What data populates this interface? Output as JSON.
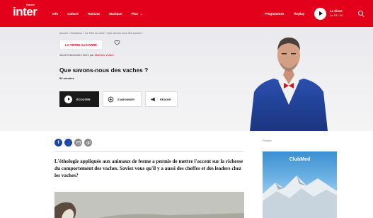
{
  "nav": {
    "logo_top": "france",
    "logo_main": "inter",
    "links": [
      "Info",
      "Culture",
      "Humour",
      "Musique",
      "Plus"
    ],
    "right_links": [
      "Programmes",
      "Replay"
    ],
    "live_label": "Le direct",
    "live_sub": "Le 13 / 14",
    "accent_color": "#e2001a"
  },
  "hero": {
    "breadcrumb": "Accueil  >  Émissions  >  La Terre au carré  >  Que savons-nous des vaches ?",
    "show_tag": "LA TERRE AU CARRÉ",
    "date_prefix": "Jeudi 9 décembre 2021 par ",
    "author": "Mathieu Vidard",
    "title": "Que savons-nous des vaches ?",
    "duration": "54 minutes",
    "actions": {
      "listen": "ÉCOUTER",
      "subscribe": "S'ABONNER",
      "react": "RÉAGIR"
    }
  },
  "article": {
    "share_icons": [
      "facebook-icon",
      "twitter-icon",
      "mail-icon",
      "link-icon"
    ],
    "lead": "L'éthologie appliquée aux animaux de ferme a permis de mettre l'accent sur la richesse du comportement des vaches. Saviez vous qu'il y a aussi des cheffes et des leaders chez les vaches?"
  },
  "sidebar": {
    "ad_label": "Publicité",
    "ad_brand": "ClubMed"
  }
}
